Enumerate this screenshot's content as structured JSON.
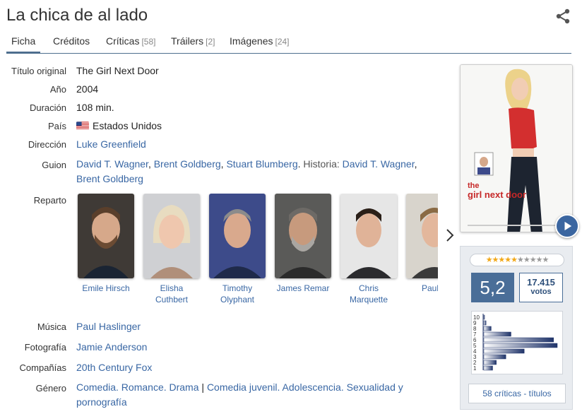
{
  "header": {
    "title": "La chica de al lado"
  },
  "tabs": [
    {
      "label": "Ficha",
      "count": ""
    },
    {
      "label": "Créditos",
      "count": ""
    },
    {
      "label": "Críticas",
      "count": "[58]"
    },
    {
      "label": "Tráilers",
      "count": "[2]"
    },
    {
      "label": "Imágenes",
      "count": "[24]"
    }
  ],
  "details": {
    "original_title": {
      "label": "Título original",
      "value": "The Girl Next Door"
    },
    "year": {
      "label": "Año",
      "value": "2004"
    },
    "duration": {
      "label": "Duración",
      "value": "108 min."
    },
    "country": {
      "label": "País",
      "value": "Estados Unidos"
    },
    "director": {
      "label": "Dirección",
      "value": "Luke Greenfield"
    },
    "screenplay": {
      "label": "Guion",
      "writers": [
        "David T. Wagner",
        "Brent Goldberg",
        "Stuart Blumberg"
      ],
      "story_label": "Historia:",
      "story": [
        "David T. Wagner",
        "Brent Goldberg"
      ]
    },
    "cast_label": "Reparto",
    "music": {
      "label": "Música",
      "value": "Paul Haslinger"
    },
    "photography": {
      "label": "Fotografía",
      "value": "Jamie Anderson"
    },
    "companies": {
      "label": "Compañías",
      "value": "20th Century Fox"
    },
    "genre": {
      "label": "Género",
      "primary": "Comedia. Romance. Drama",
      "separator": "|",
      "secondary": "Comedia juvenil. Adolescencia. Sexualidad y pornografía"
    }
  },
  "cast": [
    {
      "name": "Emile Hirsch"
    },
    {
      "name": "Elisha Cuthbert"
    },
    {
      "name": "Timothy Olyphant"
    },
    {
      "name": "James Remar"
    },
    {
      "name": "Chris Marquette"
    },
    {
      "name": "Paul D"
    }
  ],
  "rating": {
    "score": "5,2",
    "votes": "17.415",
    "votes_label": "votos",
    "stars_filled": 5,
    "stars_total": 10,
    "histogram_labels": [
      "10",
      "9",
      "8",
      "7",
      "6",
      "5",
      "4",
      "3",
      "2",
      "1"
    ],
    "histogram": [
      0.01,
      0.03,
      0.1,
      0.37,
      0.95,
      1.0,
      0.55,
      0.3,
      0.17,
      0.12
    ],
    "criticas_link": "58 críticas - títulos"
  },
  "colors": {
    "accent": "#4e6e8e",
    "link": "#3967a4",
    "score_bg": "#4a6e98",
    "star_on": "#f2a818"
  },
  "icons": {
    "share": "share-icon",
    "next": "chevron-right-icon",
    "play": "play-icon",
    "flag": "us-flag-icon"
  }
}
